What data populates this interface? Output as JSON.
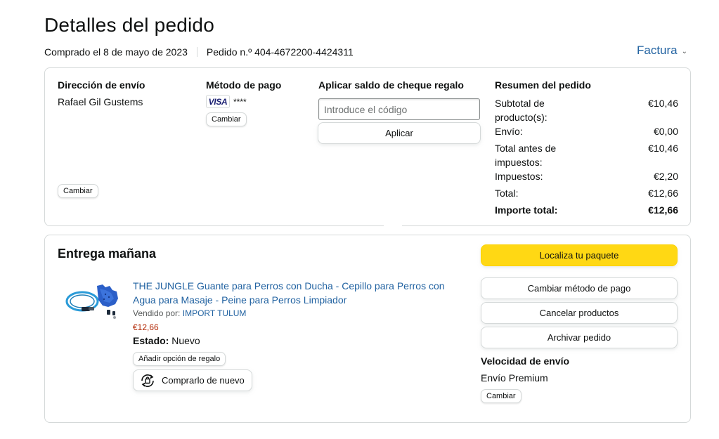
{
  "header": {
    "title": "Detalles del pedido",
    "purchased": "Comprado el 8 de mayo de 2023",
    "order_number": "Pedido n.º 404-4672200-4424311",
    "invoice_label": "Factura"
  },
  "shipping": {
    "heading": "Dirección de envío",
    "name": "Rafael Gil Gustems",
    "change_label": "Cambiar"
  },
  "payment": {
    "heading": "Método de pago",
    "card_brand": "VISA",
    "card_mask": "****",
    "change_label": "Cambiar"
  },
  "gift_card": {
    "heading": "Aplicar saldo de cheque regalo",
    "placeholder": "Introduce el código",
    "apply_label": "Aplicar"
  },
  "summary": {
    "heading": "Resumen del pedido",
    "rows": [
      {
        "label": "Subtotal de producto(s):",
        "value": "€10,46"
      },
      {
        "label": "Envío:",
        "value": "€0,00"
      },
      {
        "label": "Total antes de impuestos:",
        "value": "€10,46"
      },
      {
        "label": "Impuestos:",
        "value": "€2,20"
      },
      {
        "label": "Total:",
        "value": "€12,66"
      }
    ],
    "grand_total": {
      "label": "Importe total:",
      "value": "€12,66"
    }
  },
  "delivery": {
    "title": "Entrega mañana",
    "product": {
      "title": "THE JUNGLE Guante para Perros con Ducha - Cepillo para Perros con Agua para Masaje - Peine para Perros Limpiador",
      "sold_by_label": "Vendido por:",
      "seller": "IMPORT TULUM",
      "price": "€12,66",
      "state_label": "Estado:",
      "state_value": "Nuevo",
      "gift_label": "Añadir opción de regalo",
      "buy_again_label": "Comprarlo de nuevo"
    },
    "actions": {
      "track": "Localiza tu paquete",
      "change_payment": "Cambiar método de pago",
      "cancel": "Cancelar productos",
      "archive": "Archivar pedido"
    },
    "speed": {
      "heading": "Velocidad de envío",
      "value": "Envío Premium",
      "change_label": "Cambiar"
    }
  },
  "colors": {
    "link": "#2162a1",
    "price": "#b12704",
    "primary_button": "#ffd814",
    "border": "#d5d9d9"
  }
}
